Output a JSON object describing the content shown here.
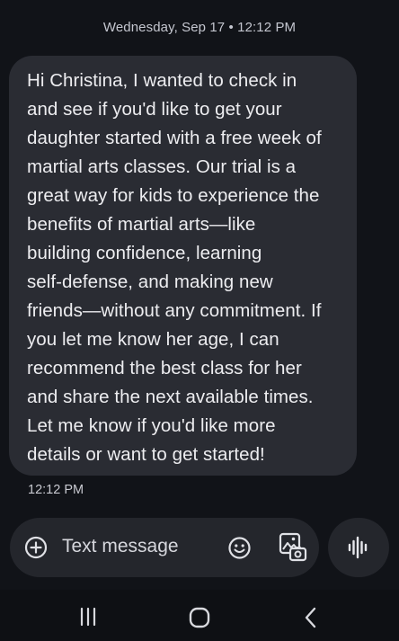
{
  "header": {
    "date": "Wednesday, Sep 17 • 12:12 PM"
  },
  "message": {
    "text": "Hi Christina, I wanted to check in\nand see if you'd like to get your\ndaughter started with a free week of\nmartial arts classes. Our trial is a\ngreat way for kids to experience the\nbenefits of martial arts—like\nbuilding confidence, learning\nself-defense, and making new\nfriends—without any commitment. If\nyou let me know her age, I can\nrecommend the best class for her\nand share the next available times.\nLet me know if you'd like more\ndetails or want to get started!",
    "time": "12:12 PM"
  },
  "compose": {
    "placeholder": "Text message",
    "icons": [
      "add-circle-icon",
      "emoji-icon",
      "gallery-icon",
      "voice-waveform-icon"
    ]
  },
  "navigation": {
    "icons": [
      "recents-icon",
      "home-icon",
      "back-icon"
    ]
  },
  "colors": {
    "background": "#111318",
    "bubble": "#2a2c33",
    "compose": "#24262c",
    "text": "#ededf0"
  }
}
